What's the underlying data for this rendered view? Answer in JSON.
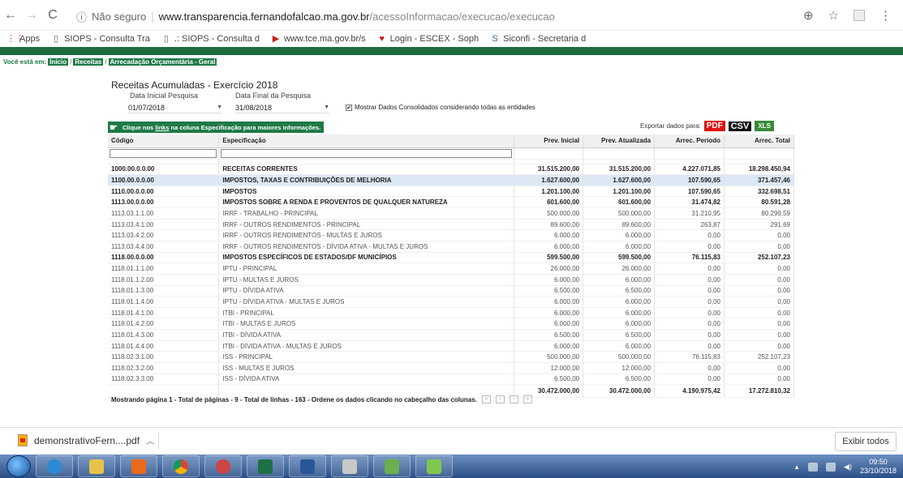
{
  "browser": {
    "security_label": "Não seguro",
    "url_host": "www.transparencia.fernandofalcao.ma.gov.br",
    "url_path": "/acessoInformacao/execucao/execucao"
  },
  "bookmarks": [
    {
      "label": "Apps",
      "icon": "apps-grid-icon"
    },
    {
      "label": "SIOPS - Consulta Tra",
      "icon": "page-icon"
    },
    {
      "label": ".: SIOPS - Consulta d",
      "icon": "page-icon"
    },
    {
      "label": "www.tce.ma.gov.br/s",
      "icon": "tce-flag-icon"
    },
    {
      "label": "Login - ESCEX - Soph",
      "icon": "book-icon"
    },
    {
      "label": "Siconfi - Secretaria d",
      "icon": "siconfi-icon"
    }
  ],
  "breadcrumb": {
    "prefix": "Você está em:",
    "items": [
      "Início",
      "Receitas",
      "Arrecadação Orçamentária - Geral"
    ]
  },
  "filters": {
    "title": "Receitas Acumuladas - Exercício 2018",
    "start_label": "Data Inicial Pesquisa",
    "start_value": "01/07/2018",
    "end_label": "Data Final da Pesquisa",
    "end_value": "31/08/2018",
    "consolidated_label": "Mostrar Dados Consolidados considerando todas as entidades",
    "consolidated_checked": true
  },
  "hint": {
    "before": "Clique nos",
    "link": "links",
    "after": "na coluna Especificação para maiores informações."
  },
  "export": {
    "label": "Exportar dados para:",
    "pdf": "PDF",
    "csv": "CSV",
    "xls": "XLS"
  },
  "table": {
    "columns": [
      "Código",
      "Especificação",
      "Prev. Inicial",
      "Prev. Atualizada",
      "Arrec. Período",
      "Arrec. Total"
    ],
    "rows": [
      [
        "1000.00.0.0.00",
        "RECEITAS CORRENTES",
        "31.515.200,00",
        "31.515.200,00",
        "4.227.071,85",
        "18.298.450,94"
      ],
      [
        "1100.00.0.0.00",
        "IMPOSTOS, TAXAS E CONTRIBUIÇÕES DE MELHORIA",
        "1.627.600,00",
        "1.627.600,00",
        "107.590,65",
        "371.457,46"
      ],
      [
        "1110.00.0.0.00",
        "IMPOSTOS",
        "1.201.100,00",
        "1.201.100,00",
        "107.590,65",
        "332.698,51"
      ],
      [
        "1113.00.0.0.00",
        "IMPOSTOS SOBRE A RENDA E PROVENTOS DE QUALQUER NATUREZA",
        "601.600,00",
        "601.600,00",
        "31.474,82",
        "80.591,28"
      ],
      [
        "1113.03.1.1.00",
        "IRRF - TRABALHO - PRINCIPAL",
        "500.000,00",
        "500.000,00",
        "31.210,95",
        "80.299,59"
      ],
      [
        "1113.03.4.1.00",
        "IRRF - OUTROS RENDIMENTOS - PRINCIPAL",
        "89.600,00",
        "89.600,00",
        "263,87",
        "291,69"
      ],
      [
        "1113.03.4.2.00",
        "IRRF - OUTROS RENDIMENTOS - MULTAS E JUROS",
        "6.000,00",
        "6.000,00",
        "0,00",
        "0,00"
      ],
      [
        "1113.03.4.4.00",
        "IRRF - OUTROS RENDIMENTOS - DÍVIDA ATIVA - MULTAS E JUROS",
        "6.000,00",
        "6.000,00",
        "0,00",
        "0,00"
      ],
      [
        "1118.00.0.0.00",
        "IMPOSTOS ESPECÍFICOS DE ESTADOS/DF MUNICÍPIOS",
        "599.500,00",
        "599.500,00",
        "76.115,83",
        "252.107,23"
      ],
      [
        "1118.01.1.1.00",
        "IPTU - PRINCIPAL",
        "26.000,00",
        "26.000,00",
        "0,00",
        "0,00"
      ],
      [
        "1118.01.1.2.00",
        "IPTU - MULTAS E JUROS",
        "6.000,00",
        "6.000,00",
        "0,00",
        "0,00"
      ],
      [
        "1118.01.1.3.00",
        "IPTU - DÍVIDA ATIVA",
        "6.500,00",
        "6.500,00",
        "0,00",
        "0,00"
      ],
      [
        "1118.01.1.4.00",
        "IPTU - DÍVIDA ATIVA - MULTAS E JUROS",
        "6.000,00",
        "6.000,00",
        "0,00",
        "0,00"
      ],
      [
        "1118.01.4.1.00",
        "ITBI - PRINCIPAL",
        "6.000,00",
        "6.000,00",
        "0,00",
        "0,00"
      ],
      [
        "1118.01.4.2.00",
        "ITBI - MULTAS E JUROS",
        "6.000,00",
        "6.000,00",
        "0,00",
        "0,00"
      ],
      [
        "1118.01.4.3.00",
        "ITBI - DÍVIDA ATIVA",
        "6.500,00",
        "6.500,00",
        "0,00",
        "0,00"
      ],
      [
        "1118.01.4.4.00",
        "ITBI - DÍVIDA ATIVA - MULTAS E JUROS",
        "6.000,00",
        "6.000,00",
        "0,00",
        "0,00"
      ],
      [
        "1118.02.3.1.00",
        "ISS - PRINCIPAL",
        "500.000,00",
        "500.000,00",
        "76.115,83",
        "252.107,23"
      ],
      [
        "1118.02.3.2.00",
        "ISS - MULTAS E JUROS",
        "12.000,00",
        "12.000,00",
        "0,00",
        "0,00"
      ],
      [
        "1118.02.3.3.00",
        "ISS - DÍVIDA ATIVA",
        "6.500,00",
        "6.500,00",
        "0,00",
        "0,00"
      ]
    ],
    "bold_rows": [
      0,
      1,
      2,
      3,
      8
    ],
    "highlight_row": 1,
    "totals": [
      "",
      "",
      "30.472.000,00",
      "30.472.000,00",
      "4.190.975,42",
      "17.272.810,32"
    ]
  },
  "pager": {
    "text": "Mostrando página 1 - Total de páginas - 9 - Total de linhas - 163 - Ordene os dados clicando no cabeçalho das colunas."
  },
  "downloads": {
    "file": "demonstrativoFern....pdf",
    "show_all": "Exibir todos"
  },
  "taskbar": {
    "time": "09:50",
    "date": "23/10/2018"
  }
}
